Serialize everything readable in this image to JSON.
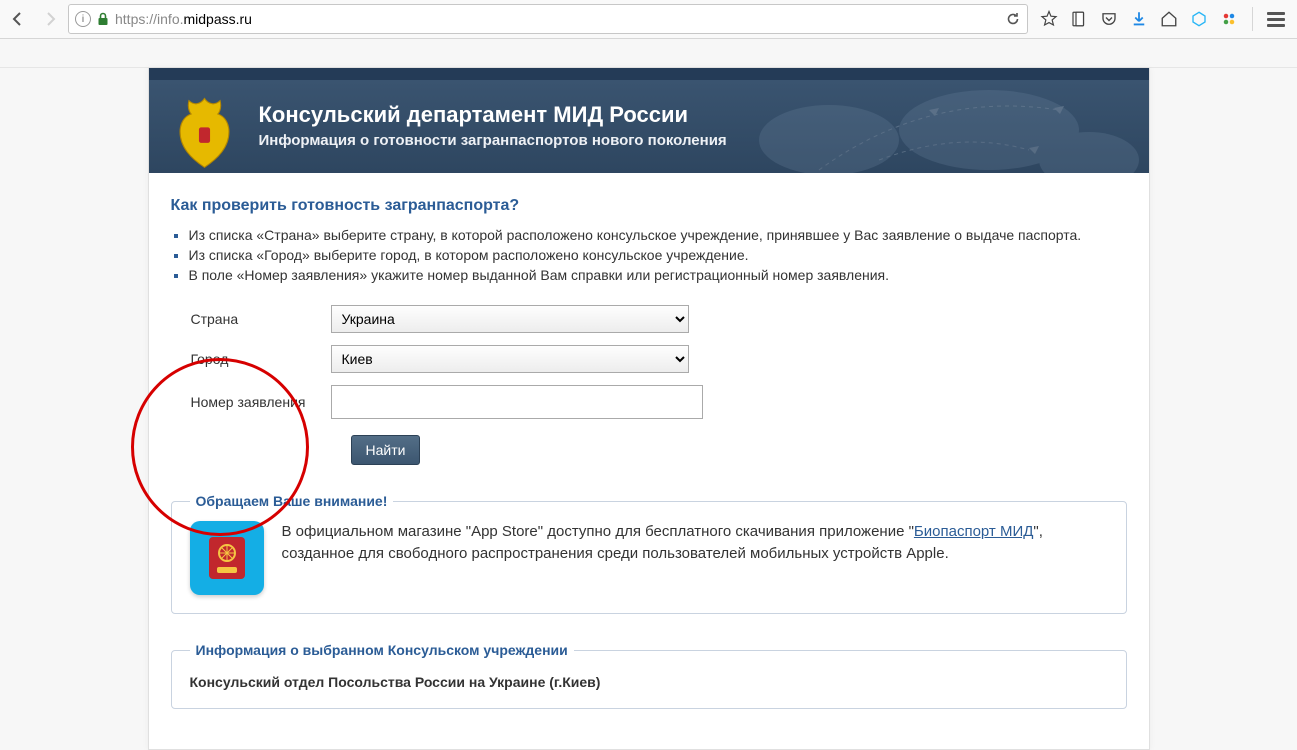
{
  "browser": {
    "url_prefix": "https://",
    "url_host_dim": "info.",
    "url_host": "midpass.ru"
  },
  "header": {
    "title": "Консульский департамент МИД России",
    "subtitle": "Информация о готовности загранпаспортов нового поколения"
  },
  "question": "Как проверить готовность загранпаспорта?",
  "instructions": [
    "Из списка «Страна» выберите страну, в которой расположено консульское учреждение, принявшее у Вас заявление о выдаче паспорта.",
    "Из списка «Город» выберите город, в котором расположено консульское учреждение.",
    "В поле «Номер заявления» укажите номер выданной Вам справки или регистрационный номер заявления."
  ],
  "form": {
    "country_label": "Страна",
    "country_value": "Украина",
    "city_label": "Город",
    "city_value": "Киев",
    "appnum_label": "Номер заявления",
    "appnum_value": "",
    "submit": "Найти"
  },
  "notice": {
    "legend": "Обращаем Ваше внимание!",
    "text_before": "В официальном магазине \"App Store\" доступно для бесплатного скачивания приложение \"",
    "link": "Биопаспорт МИД",
    "text_after": "\", созданное для свободного распространения среди пользователей мобильных устройств Apple."
  },
  "infobox": {
    "legend": "Информация о выбранном Консульском учреждении",
    "title": "Консульский отдел Посольства России на Украине (г.Киев)"
  }
}
